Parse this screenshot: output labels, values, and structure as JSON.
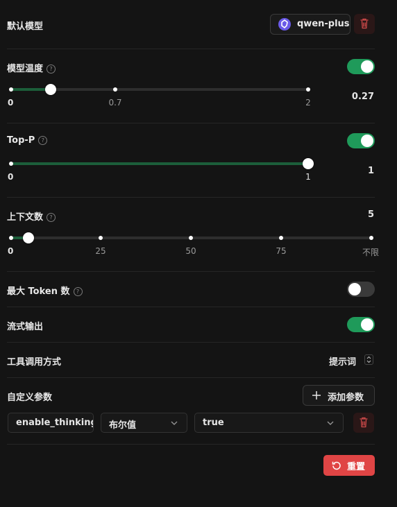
{
  "default_model": {
    "label": "默认模型",
    "model_name": "qwen-plus",
    "model_icon": "qwen-logo-icon",
    "delete_icon": "trash-icon"
  },
  "temperature": {
    "label": "模型温度",
    "enabled": true,
    "value": "0.27",
    "ticks": [
      "0",
      "0.7",
      "2"
    ]
  },
  "top_p": {
    "label": "Top-P",
    "enabled": true,
    "value": "1",
    "ticks": [
      "0",
      "1"
    ]
  },
  "context_count": {
    "label": "上下文数",
    "value": "5",
    "ticks": [
      "0",
      "25",
      "50",
      "75",
      "不限"
    ]
  },
  "max_token": {
    "label": "最大 Token 数",
    "enabled": false
  },
  "streaming": {
    "label": "流式输出",
    "enabled": true
  },
  "tool_call": {
    "label": "工具调用方式",
    "selected": "提示词"
  },
  "custom_params": {
    "label": "自定义参数",
    "add_button": "添加参数",
    "params": [
      {
        "name": "enable_thinking",
        "type": "布尔值",
        "value": "true"
      }
    ]
  },
  "reset_button": "重置",
  "colors": {
    "accent_green": "#1f9a5a",
    "reset_red": "#e04545",
    "background": "#141414"
  }
}
